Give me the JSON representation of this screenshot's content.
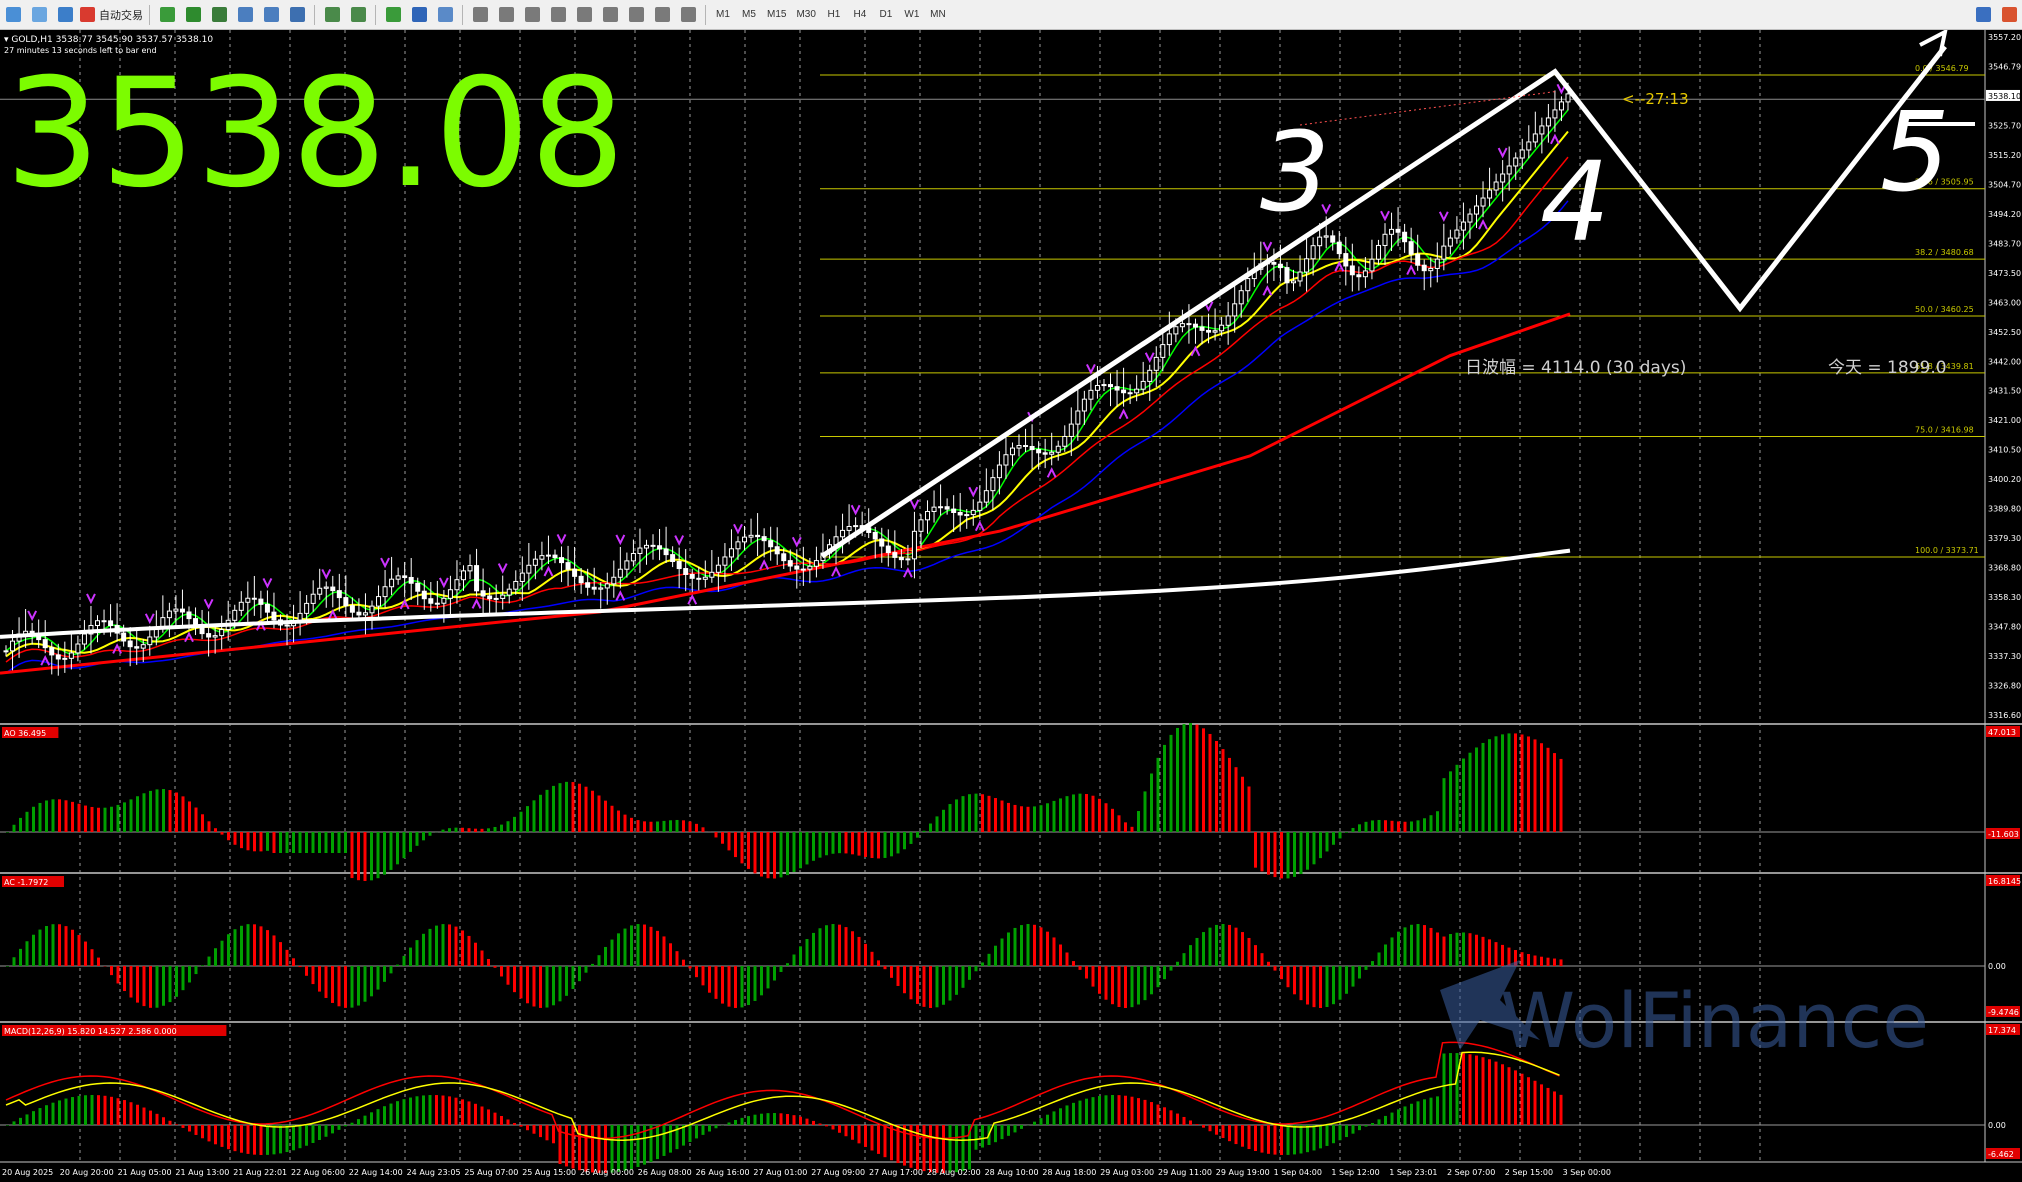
{
  "toolbar": {
    "autotrade_label": "自动交易",
    "timeframes": [
      "M1",
      "M5",
      "M15",
      "M30",
      "H1",
      "H4",
      "D1",
      "W1",
      "MN"
    ]
  },
  "header": {
    "symbol_info": "GOLD,H1  3538.77 3545.90 3537.57 3538.10",
    "bar_timer": "27 minutes 13 seconds left to bar end",
    "big_price": "3538.08",
    "countdown": "<--27:13",
    "range_text": "日波幅 = 4114.0  (30 days)",
    "today_text": "今天 = 1899.0"
  },
  "price_axis": {
    "labels": [
      "3557.20",
      "3546.79",
      "3538.10",
      "3525.70",
      "3515.20",
      "3504.70",
      "3494.20",
      "3483.70",
      "3473.50",
      "3463.00",
      "3452.50",
      "3442.00",
      "3431.50",
      "3421.00",
      "3410.50",
      "3400.20",
      "3389.80",
      "3379.30",
      "3368.80",
      "3358.30",
      "3347.80",
      "3337.30",
      "3326.80",
      "3316.60"
    ],
    "current": "3538.10",
    "fib_tags": [
      "3546.79",
      "3505.95",
      "3480.68",
      "3460.25",
      "3439.81",
      "3416.98",
      "3373.71"
    ]
  },
  "fibonacci": {
    "levels": [
      "0.0",
      "23.6",
      "38.2",
      "50.0",
      "61.8",
      "75.0",
      "100.0"
    ]
  },
  "indicators": {
    "ao": {
      "label": "AO 36.495",
      "axis": [
        "47.013",
        "0.00",
        "-11.603"
      ]
    },
    "ac": {
      "label": "AC -1.7972",
      "axis": [
        "16.8145",
        "0.00",
        "-9.4746"
      ]
    },
    "macd": {
      "label": "MACD(12,26,9) 15.820 14.527 2.586 0.000",
      "axis": [
        "17.374",
        "0.00",
        "-6.462"
      ]
    }
  },
  "time_axis": {
    "labels": [
      "20 Aug 2025",
      "20 Aug 20:00",
      "21 Aug 05:00",
      "21 Aug 13:00",
      "21 Aug 22:01",
      "22 Aug 06:00",
      "22 Aug 14:00",
      "24 Aug 23:05",
      "25 Aug 07:00",
      "25 Aug 15:00",
      "26 Aug 00:00",
      "26 Aug 08:00",
      "26 Aug 16:00",
      "27 Aug 01:00",
      "27 Aug 09:00",
      "27 Aug 17:00",
      "28 Aug 02:00",
      "28 Aug 10:00",
      "28 Aug 18:00",
      "29 Aug 03:00",
      "29 Aug 11:00",
      "29 Aug 19:00",
      "1 Sep 04:00",
      "1 Sep 12:00",
      "1 Sep 23:01",
      "2 Sep 07:00",
      "2 Sep 15:00",
      "3 Sep 00:00"
    ]
  },
  "annotations": {
    "wave_labels": [
      "3",
      "4",
      "5"
    ]
  },
  "watermark": "WolFinance",
  "colors": {
    "big_price": "#7cfc00",
    "bull": "#00a000",
    "bear": "#ff0000",
    "fib": "#c8c800",
    "ma_fast": "#00ff00",
    "ma_yellow": "#ffff00",
    "ma_red": "#ff0000",
    "ma_blue": "#0000ff",
    "drawing": "#ffffff",
    "fractal": "#cc33ff"
  }
}
